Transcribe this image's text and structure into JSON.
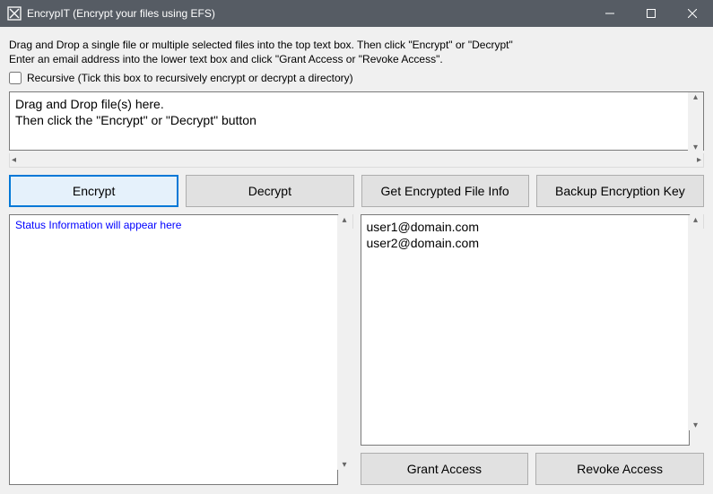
{
  "titlebar": {
    "title": "EncrypIT (Encrypt your files using EFS)"
  },
  "instructions": {
    "line1": "Drag and Drop a single file or multiple selected files into the top text box. Then click \"Encrypt\" or \"Decrypt\"",
    "line2": "Enter an email address into the lower text box and click \"Grant Access or \"Revoke Access\"."
  },
  "recursive": {
    "label": "Recursive (Tick this box to recursively encrypt or decrypt a directory)",
    "checked": false
  },
  "filebox": {
    "value": "Drag and Drop file(s) here.\nThen click the \"Encrypt\" or \"Decrypt\" button"
  },
  "buttons": {
    "encrypt": "Encrypt",
    "decrypt": "Decrypt",
    "get_info": "Get Encrypted File Info",
    "backup_key": "Backup Encryption Key",
    "grant": "Grant Access",
    "revoke": "Revoke Access"
  },
  "statusbox": {
    "value": "Status Information will appear here"
  },
  "emailbox": {
    "value": "user1@domain.com\nuser2@domain.com"
  }
}
